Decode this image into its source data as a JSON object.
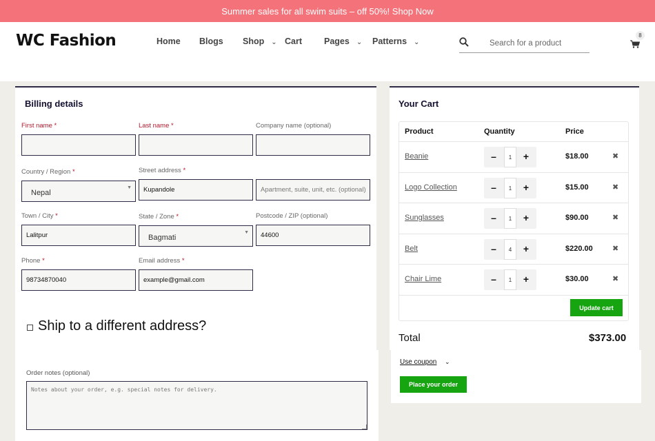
{
  "announcement": "Summer sales for all swim suits – off 50%! Shop Now",
  "brand": "WC Fashion",
  "nav": {
    "home": "Home",
    "blogs": "Blogs",
    "shop": "Shop",
    "cart": "Cart",
    "pages": "Pages",
    "patterns": "Patterns",
    "chevron": "⌄"
  },
  "search": {
    "placeholder": "Search for a product"
  },
  "cart_count": "8",
  "billing": {
    "title": "Billing details",
    "star": "*",
    "first_name_label": "First name",
    "first_name_value": "",
    "last_name_label": "Last name",
    "last_name_value": "",
    "company_label": "Company name (optional)",
    "company_value": "",
    "country_label": "Country / Region",
    "country_value": "Nepal",
    "street_label": "Street address",
    "street_value": "Kupandole",
    "apartment_placeholder": "Apartment, suite, unit, etc. (optional)",
    "town_label": "Town / City",
    "town_value": "Lalitpur",
    "state_label": "State / Zone",
    "state_value": "Bagmati",
    "postcode_label": "Postcode / ZIP (optional)",
    "postcode_value": "44600",
    "phone_label": "Phone",
    "phone_value": "98734870040",
    "email_label": "Email address",
    "email_value": "example@gmail.com",
    "ship_label": "Ship to a different address?",
    "notes_label": "Order notes (optional)",
    "notes_placeholder": "Notes about your order, e.g. special notes for delivery."
  },
  "cart": {
    "title": "Your Cart",
    "headers": {
      "product": "Product",
      "quantity": "Quantity",
      "price": "Price"
    },
    "items": [
      {
        "name": "Beanie",
        "qty": "1",
        "price": "$18.00"
      },
      {
        "name": "Logo Collection",
        "qty": "1",
        "price": "$15.00"
      },
      {
        "name": "Sunglasses",
        "qty": "1",
        "price": "$90.00"
      },
      {
        "name": "Belt",
        "qty": "4",
        "price": "$220.00"
      },
      {
        "name": "Chair Lime",
        "qty": "1",
        "price": "$30.00"
      }
    ],
    "minus": "–",
    "plus": "+",
    "remove": "✖",
    "update_button": "Update cart",
    "total_label": "Total",
    "total_value": "$373.00",
    "coupon_label": "Use coupon",
    "coupon_chevron": "⌄",
    "place_order_button": "Place your order"
  },
  "colors": {
    "banner": "#f4727a",
    "button_green": "#17a411",
    "dark_border": "#2d2a46",
    "page_bg": "#efeee9"
  },
  "icons": {
    "search": "search-icon",
    "cart": "cart-icon",
    "remove": "close-icon",
    "select": "chevron-down-icon"
  }
}
